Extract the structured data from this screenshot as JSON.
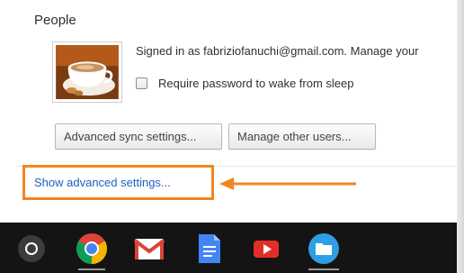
{
  "people": {
    "title": "People",
    "signed_in_text": "Signed in as fabriziofanuchi@gmail.com. Manage your",
    "require_password_label": "Require password to wake from sleep",
    "require_password_checked": false,
    "advanced_sync_button": "Advanced sync settings...",
    "manage_users_button": "Manage other users..."
  },
  "advanced_link": "Show advanced settings...",
  "colors": {
    "highlight": "#f0861f",
    "link": "#1f5fc0",
    "taskbar": "#141414"
  },
  "shelf": {
    "apps": [
      "launcher-icon",
      "chrome-icon",
      "gmail-icon",
      "docs-icon",
      "youtube-icon",
      "files-icon"
    ],
    "running": [
      "chrome-icon",
      "files-icon"
    ]
  }
}
